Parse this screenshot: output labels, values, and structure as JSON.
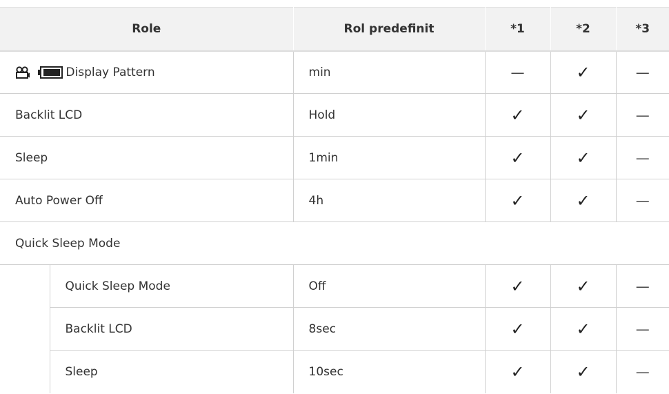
{
  "header": {
    "role": "Role",
    "default": "Rol predefinit",
    "col1": "*1",
    "col2": "*2",
    "col3": "*3"
  },
  "rows": [
    {
      "role": "Display Pattern",
      "default": "min",
      "c1": "—",
      "c2": "✓",
      "c3": "—",
      "icons": [
        "movie-icon",
        "battery-icon"
      ]
    },
    {
      "role": "Backlit LCD",
      "default": "Hold",
      "c1": "✓",
      "c2": "✓",
      "c3": "—"
    },
    {
      "role": "Sleep",
      "default": "1min",
      "c1": "✓",
      "c2": "✓",
      "c3": "—"
    },
    {
      "role": "Auto Power Off",
      "default": "4h",
      "c1": "✓",
      "c2": "✓",
      "c3": "—"
    }
  ],
  "section": {
    "title": "Quick Sleep Mode",
    "rows": [
      {
        "role": "Quick Sleep Mode",
        "default": "Off",
        "c1": "✓",
        "c2": "✓",
        "c3": "—"
      },
      {
        "role": "Backlit LCD",
        "default": "8sec",
        "c1": "✓",
        "c2": "✓",
        "c3": "—"
      },
      {
        "role": "Sleep",
        "default": "10sec",
        "c1": "✓",
        "c2": "✓",
        "c3": "—"
      }
    ]
  }
}
